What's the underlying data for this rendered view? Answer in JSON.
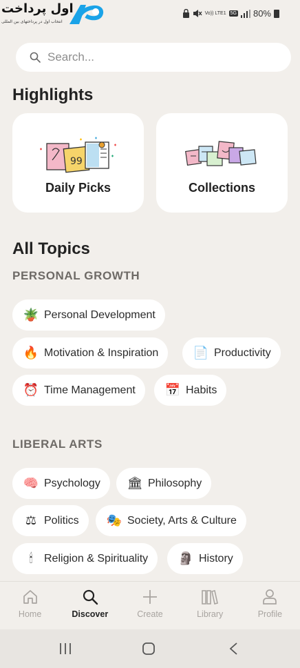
{
  "status_bar": {
    "watermark_text": "اول پرداخت",
    "watermark_sub": "انتخاب اول در پرداختهای بین المللی",
    "volte": "Vo)) LTE1",
    "network": "5G",
    "battery": "80%"
  },
  "search": {
    "placeholder": "Search..."
  },
  "highlights": {
    "title": "Highlights",
    "cards": [
      {
        "label": "Daily Picks"
      },
      {
        "label": "Collections"
      }
    ]
  },
  "topics": {
    "title": "All Topics",
    "categories": [
      {
        "title": "PERSONAL GROWTH",
        "chips": [
          {
            "emoji": "🪴",
            "label": "Personal Development"
          },
          {
            "emoji": "🔥",
            "label": "Motivation & Inspiration"
          },
          {
            "emoji": "📄",
            "label": "Productivity"
          },
          {
            "emoji": "⏰",
            "label": "Time Management"
          },
          {
            "emoji": "📅",
            "label": "Habits"
          }
        ]
      },
      {
        "title": "LIBERAL ARTS",
        "chips": [
          {
            "emoji": "🧠",
            "label": "Psychology"
          },
          {
            "emoji": "🏛",
            "label": "Philosophy"
          },
          {
            "emoji": "⚖",
            "label": "Politics"
          },
          {
            "emoji": "🎭",
            "label": "Society, Arts & Culture"
          },
          {
            "emoji": "🕯",
            "label": "Religion & Spirituality"
          },
          {
            "emoji": "🗿",
            "label": "History"
          }
        ]
      }
    ]
  },
  "bottom_nav": {
    "items": [
      {
        "label": "Home",
        "icon": "home-icon"
      },
      {
        "label": "Discover",
        "icon": "search-icon",
        "active": true
      },
      {
        "label": "Create",
        "icon": "plus-icon"
      },
      {
        "label": "Library",
        "icon": "library-icon"
      },
      {
        "label": "Profile",
        "icon": "profile-icon"
      }
    ]
  },
  "colors": {
    "background": "#f2efeb",
    "card": "#ffffff",
    "category": "#6e6a66",
    "inactive": "#a8a4a0"
  }
}
